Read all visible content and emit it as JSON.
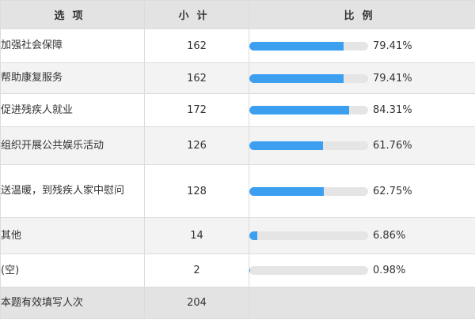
{
  "headers": {
    "option": "选项",
    "count": "小计",
    "ratio": "比例"
  },
  "rows": [
    {
      "option": "加强社会保障",
      "count": "162",
      "percent": "79.41%",
      "fraction": 0.7941
    },
    {
      "option": "帮助康复服务",
      "count": "162",
      "percent": "79.41%",
      "fraction": 0.7941
    },
    {
      "option": "促进残疾人就业",
      "count": "172",
      "percent": "84.31%",
      "fraction": 0.8431
    },
    {
      "option": "组织开展公共娱乐活动",
      "count": "126",
      "percent": "61.76%",
      "fraction": 0.6176
    },
    {
      "option": "送温暖，到残疾人家中慰问",
      "count": "128",
      "percent": "62.75%",
      "fraction": 0.6275
    },
    {
      "option": "其他",
      "count": "14",
      "percent": "6.86%",
      "fraction": 0.0686
    },
    {
      "option": "(空)",
      "count": "2",
      "percent": "0.98%",
      "fraction": 0.0098
    }
  ],
  "total": {
    "label": "本题有效填写人次",
    "count": "204"
  },
  "colors": {
    "bar_fill": "#3d9ff0",
    "bar_track": "#e5e5e5",
    "header_bg": "#e3e3e3",
    "row_alt_bg": "#f3f3f3"
  }
}
